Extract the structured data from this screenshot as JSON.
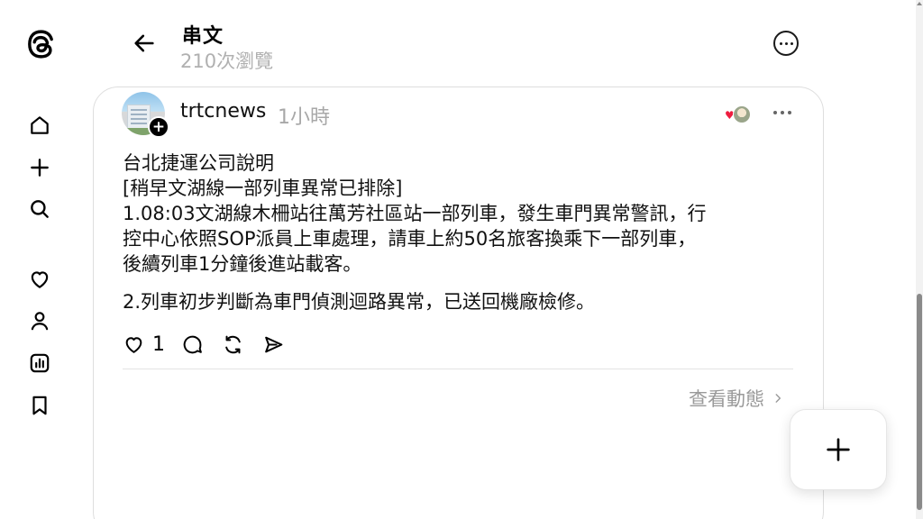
{
  "header": {
    "title": "串文",
    "view_count": "210次瀏覽"
  },
  "sidebar": {
    "items": [
      {
        "name": "home-icon",
        "label": "首頁"
      },
      {
        "name": "plus-icon",
        "label": "建立"
      },
      {
        "name": "search-icon",
        "label": "搜尋"
      },
      {
        "name": "heart-icon",
        "label": "動態"
      },
      {
        "name": "profile-icon",
        "label": "個人檔案"
      },
      {
        "name": "insights-icon",
        "label": "洞察報告"
      },
      {
        "name": "bookmark-icon",
        "label": "已儲存"
      }
    ]
  },
  "post": {
    "author": "trtcnews",
    "time": "1小時",
    "lines": [
      "台北捷運公司說明",
      "[稍早文湖線一部列車異常已排除]",
      "1.08:03文湖線木柵站往萬芳社區站一部列車，發生車門異常警訊，行",
      "控中心依照SOP派員上車處理，請車上約50名旅客換乘下一部列車，",
      "後續列車1分鐘後進站載客。"
    ],
    "paragraph2": "2.列車初步判斷為車門偵測迴路異常，已送回機廠檢修。",
    "like_count": "1",
    "activity_link": "查看動態"
  },
  "colors": {
    "background": "#ffffff",
    "muted_text": "#a8a8a8",
    "border": "#dedede",
    "heart_red": "#ee1d3f"
  }
}
